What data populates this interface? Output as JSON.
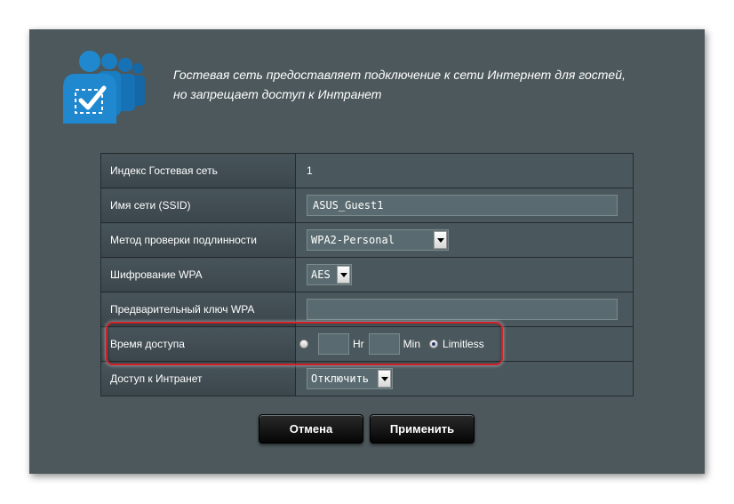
{
  "description": {
    "line1": "Гостевая сеть предоставляет подключение к сети Интернет для гостей,",
    "line2": "но запрещает доступ к Интранет"
  },
  "form": {
    "index": {
      "label": "Индекс Гостевая сеть",
      "value": "1"
    },
    "ssid": {
      "label": "Имя сети (SSID)",
      "value": "ASUS_Guest1"
    },
    "auth": {
      "label": "Метод проверки подлинности",
      "value": "WPA2-Personal"
    },
    "encryption": {
      "label": "Шифрование WPA",
      "value": "AES"
    },
    "psk": {
      "label": "Предварительный ключ WPA",
      "value": ""
    },
    "access_time": {
      "label": "Время доступа",
      "hr_label": "Hr",
      "min_label": "Min",
      "limitless_label": "Limitless",
      "selected": "limitless"
    },
    "intranet": {
      "label": "Доступ к Интранет",
      "value": "Отключить"
    }
  },
  "buttons": {
    "cancel": "Отмена",
    "apply": "Применить"
  },
  "colors": {
    "panel": "#4d585c",
    "highlight": "#d0222b",
    "icon": "#1e83c5"
  }
}
